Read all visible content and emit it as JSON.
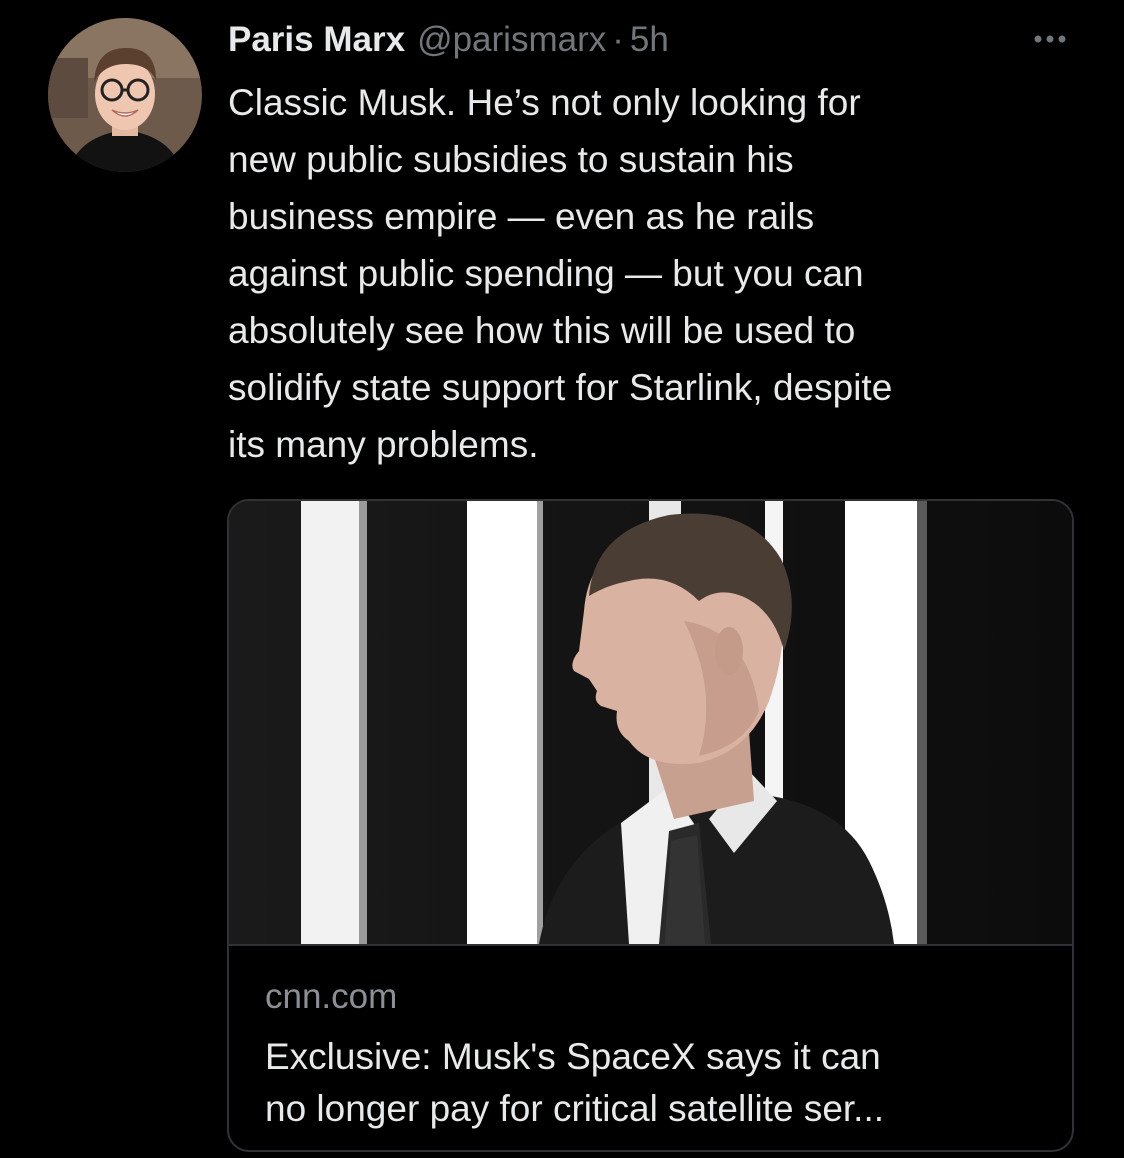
{
  "author": {
    "display_name": "Paris Marx",
    "handle": "@parismarx",
    "separator": "·",
    "time": "5h"
  },
  "icons": {
    "more": "more-horizontal-icon",
    "avatar": "avatar-photo"
  },
  "tweet": {
    "text": "Classic Musk. He’s not only looking for\nnew public subsidies to sustain his\nbusiness empire — even as he rails\nagainst public spending — but you can\nabsolutely see how this will be used to\nsolidify state support for Starlink, despite\nits many problems."
  },
  "link_card": {
    "domain": "cnn.com",
    "title_line1": "Exclusive: Musk's SpaceX says it can",
    "title_line2": "no longer pay for critical satellite ser..."
  },
  "colors": {
    "background": "#000000",
    "primary_text": "#e7e9ea",
    "secondary_text": "#71767b",
    "border": "#2f3336"
  }
}
